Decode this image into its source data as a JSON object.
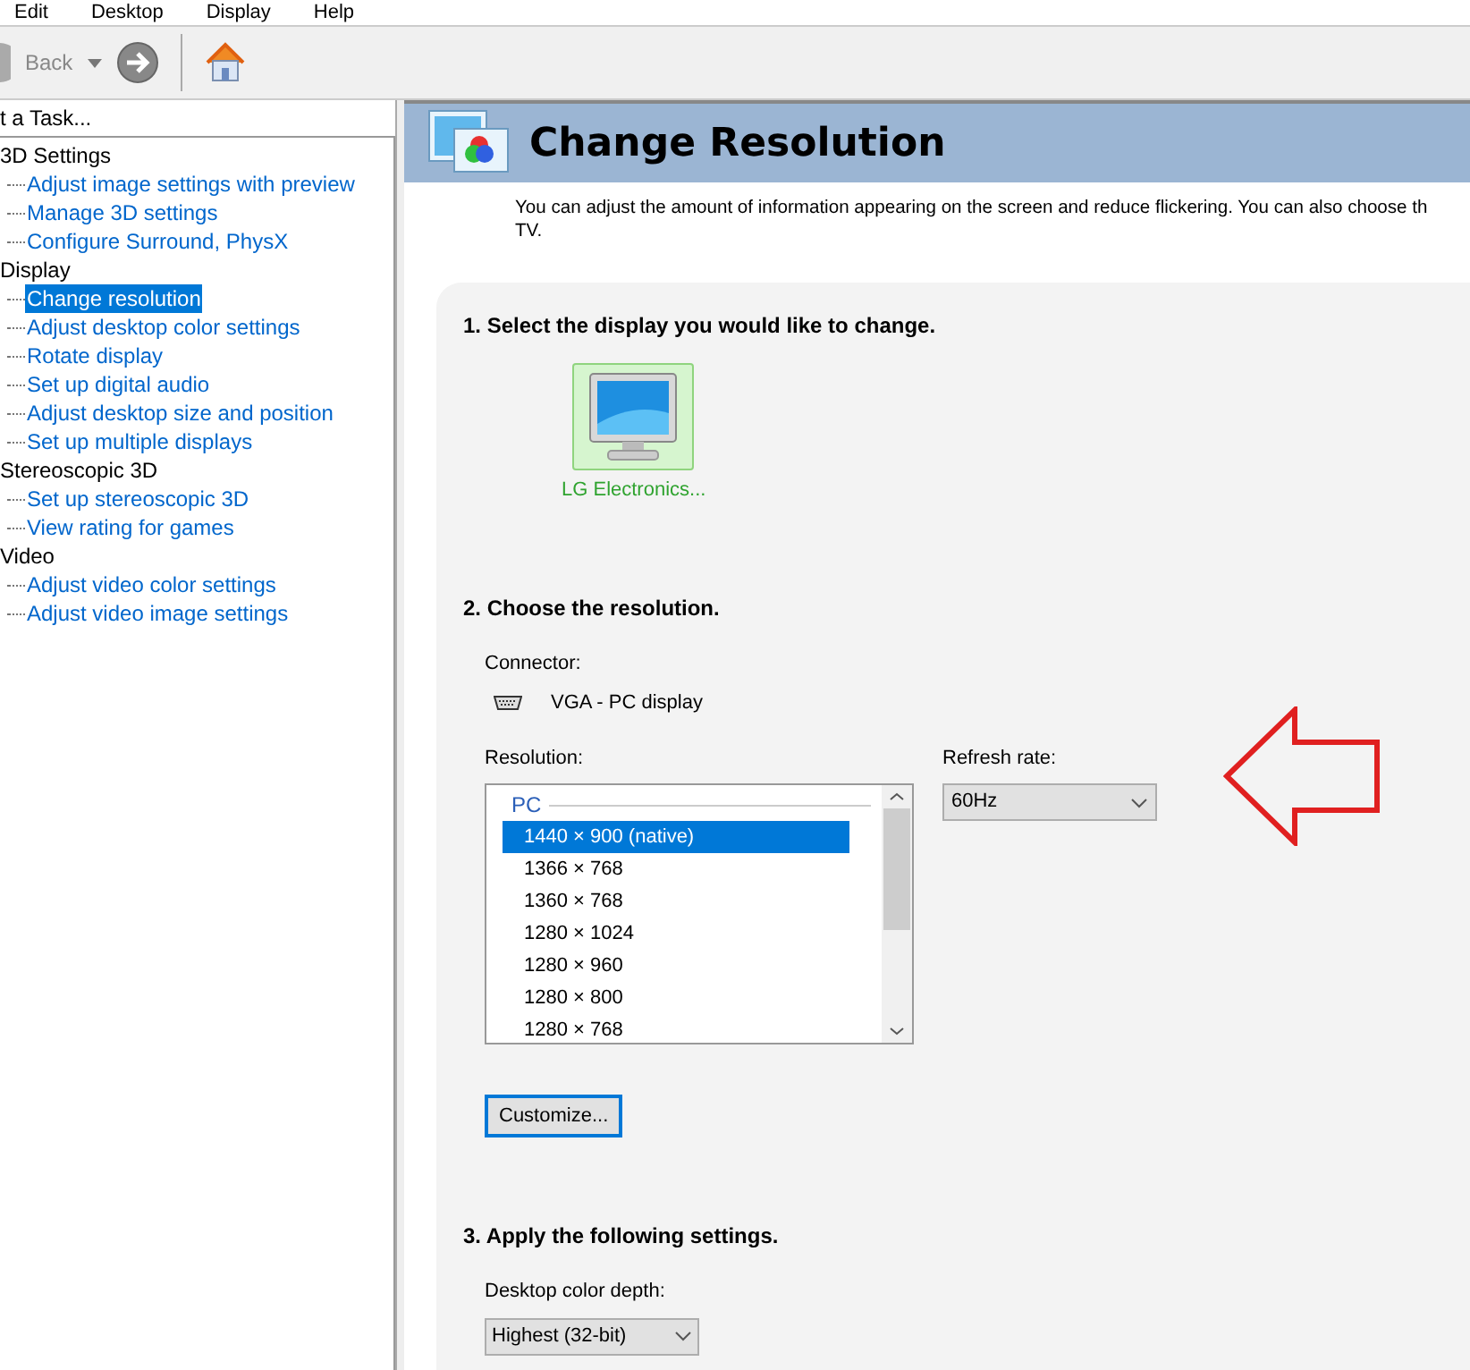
{
  "menu": [
    "Edit",
    "Desktop",
    "Display",
    "Help"
  ],
  "toolbar": {
    "back": "Back"
  },
  "sidebar": {
    "header": "t a Task...",
    "groups": [
      {
        "label": "3D Settings",
        "children": [
          {
            "label": "Adjust image settings with preview",
            "selected": false
          },
          {
            "label": "Manage 3D settings",
            "selected": false
          },
          {
            "label": "Configure Surround, PhysX",
            "selected": false
          }
        ]
      },
      {
        "label": "Display",
        "children": [
          {
            "label": "Change resolution",
            "selected": true
          },
          {
            "label": "Adjust desktop color settings",
            "selected": false
          },
          {
            "label": "Rotate display",
            "selected": false
          },
          {
            "label": "Set up digital audio",
            "selected": false
          },
          {
            "label": "Adjust desktop size and position",
            "selected": false
          },
          {
            "label": "Set up multiple displays",
            "selected": false
          }
        ]
      },
      {
        "label": "Stereoscopic 3D",
        "children": [
          {
            "label": "Set up stereoscopic 3D",
            "selected": false
          },
          {
            "label": "View rating for games",
            "selected": false
          }
        ]
      },
      {
        "label": "Video",
        "children": [
          {
            "label": "Adjust video color settings",
            "selected": false
          },
          {
            "label": "Adjust video image settings",
            "selected": false
          }
        ]
      }
    ]
  },
  "page": {
    "title": "Change Resolution",
    "description": [
      "You can adjust the amount of information appearing on the screen and reduce flickering. You can also choose th",
      "TV."
    ],
    "step1": {
      "heading": "1. Select the display you would like to change.",
      "displays": [
        {
          "label": "LG Electronics...",
          "selected": true
        }
      ]
    },
    "step2": {
      "heading": "2. Choose the resolution.",
      "connector_label": "Connector:",
      "connector": "VGA - PC display",
      "resolution_label": "Resolution:",
      "group": "PC",
      "resolutions": [
        {
          "label": "1440 × 900 (native)",
          "selected": true
        },
        {
          "label": "1366 × 768",
          "selected": false
        },
        {
          "label": "1360 × 768",
          "selected": false
        },
        {
          "label": "1280 × 1024",
          "selected": false
        },
        {
          "label": "1280 × 960",
          "selected": false
        },
        {
          "label": "1280 × 800",
          "selected": false
        },
        {
          "label": "1280 × 768",
          "selected": false
        }
      ],
      "refresh_label": "Refresh rate:",
      "refresh": "60Hz",
      "customize": "Customize..."
    },
    "step3": {
      "heading": "3. Apply the following settings.",
      "depth_label": "Desktop color depth:",
      "depth": "Highest (32-bit)"
    }
  }
}
